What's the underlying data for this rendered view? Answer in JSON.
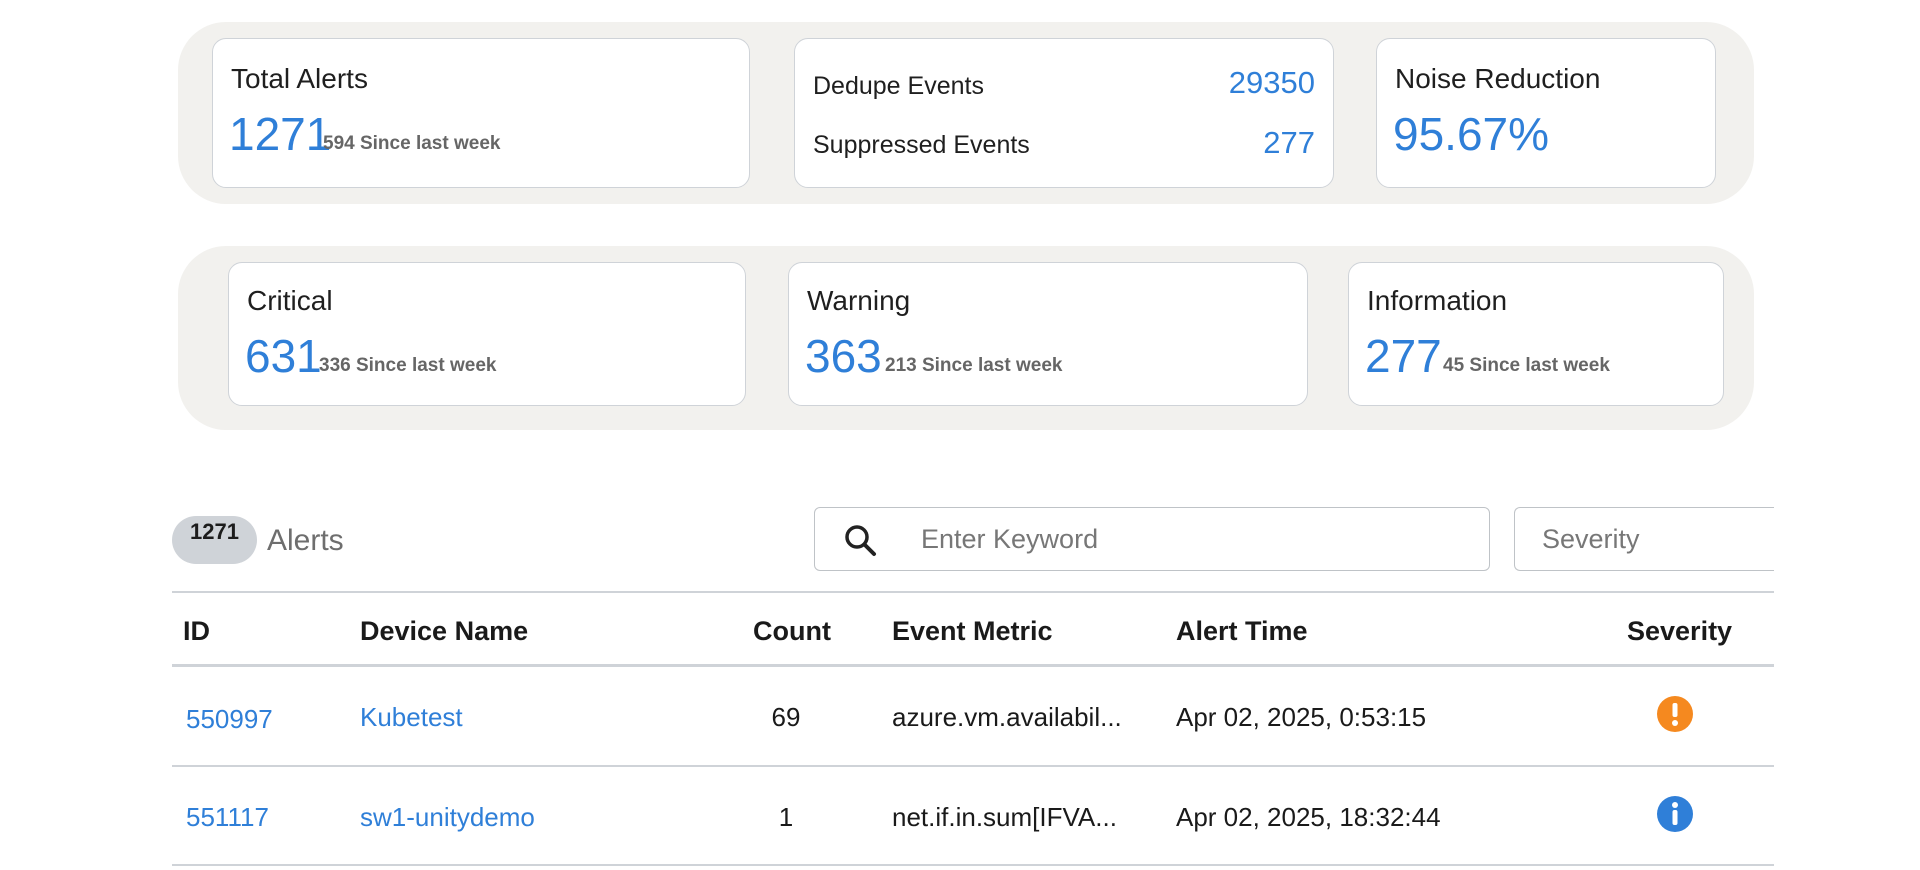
{
  "summary": {
    "total_alerts": {
      "label": "Total Alerts",
      "value": "1271",
      "since": "594 Since last week"
    },
    "events": {
      "dedupe_label": "Dedupe Events",
      "dedupe_value": "29350",
      "suppressed_label": "Suppressed Events",
      "suppressed_value": "277"
    },
    "noise_reduction": {
      "label": "Noise Reduction",
      "value": "95.67%"
    }
  },
  "severity_cards": {
    "critical": {
      "label": "Critical",
      "value": "631",
      "since": "336 Since last week"
    },
    "warning": {
      "label": "Warning",
      "value": "363",
      "since": "213 Since last week"
    },
    "information": {
      "label": "Information",
      "value": "277",
      "since": "45 Since last week"
    }
  },
  "toolbar": {
    "count": "1271",
    "title": "Alerts",
    "search_placeholder": "Enter Keyword",
    "severity_placeholder": "Severity"
  },
  "table": {
    "columns": [
      "ID",
      "Device Name",
      "Count",
      "Event Metric",
      "Alert Time",
      "Severity"
    ],
    "rows": [
      {
        "id": "550997",
        "device": "Kubetest",
        "count": "69",
        "metric": "azure.vm.availabil...",
        "time": "Apr 02, 2025, 0:53:15",
        "severity": "warning-icon"
      },
      {
        "id": "551117",
        "device": "sw1-unitydemo",
        "count": "1",
        "metric": "net.if.in.sum[IFVA...",
        "time": "Apr 02, 2025, 18:32:44",
        "severity": "info-icon"
      }
    ]
  },
  "colors": {
    "accent": "#2f7fd8",
    "warning": "#f5891f",
    "info": "#2f7fd8",
    "panel": "#f2f1ee"
  }
}
